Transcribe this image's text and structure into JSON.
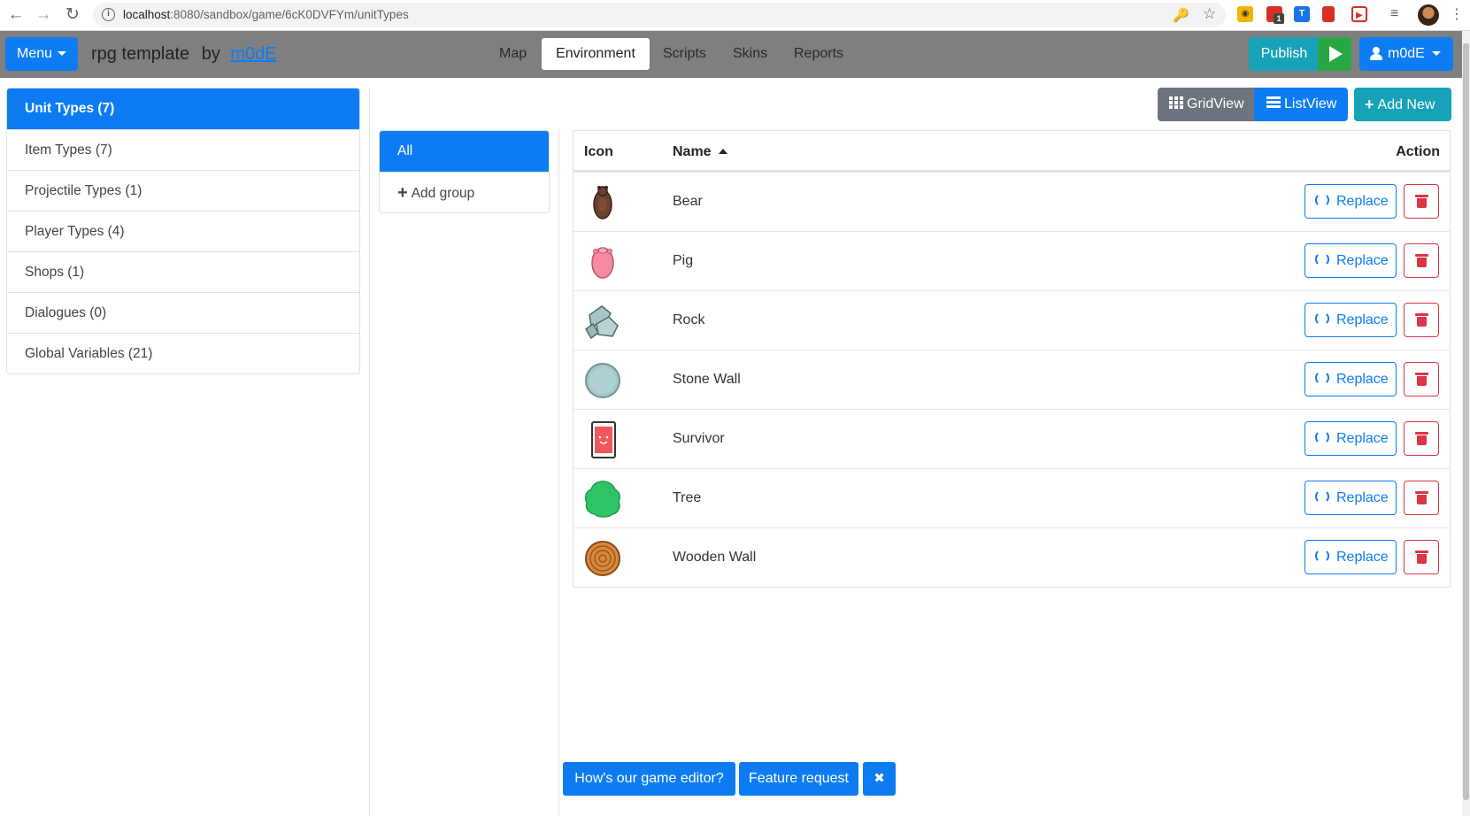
{
  "browser": {
    "url_host": "localhost",
    "url_rest": ":8080/sandbox/game/6cK0DVFYm/unitTypes",
    "extension_badge": "1"
  },
  "header": {
    "menu_label": "Menu",
    "game_title": "rpg template",
    "by_label": "by",
    "author": "m0dE",
    "tabs": [
      {
        "label": "Map"
      },
      {
        "label": "Environment"
      },
      {
        "label": "Scripts"
      },
      {
        "label": "Skins"
      },
      {
        "label": "Reports"
      }
    ],
    "publish_label": "Publish",
    "user_label": "m0dE"
  },
  "sidebar": {
    "items": [
      {
        "label": "Unit Types (7)"
      },
      {
        "label": "Item Types (7)"
      },
      {
        "label": "Projectile Types (1)"
      },
      {
        "label": "Player Types (4)"
      },
      {
        "label": "Shops (1)"
      },
      {
        "label": "Dialogues (0)"
      },
      {
        "label": "Global Variables (21)"
      }
    ]
  },
  "groups": {
    "all_label": "All",
    "add_label": "Add group"
  },
  "toolbar": {
    "grid_label": "GridView",
    "list_label": "ListView",
    "add_new_label": "Add New"
  },
  "table": {
    "headers": {
      "icon": "Icon",
      "name": "Name",
      "action": "Action"
    },
    "replace_label": "Replace",
    "rows": [
      {
        "name": "Bear",
        "icon": "bear-icon"
      },
      {
        "name": "Pig",
        "icon": "pig-icon"
      },
      {
        "name": "Rock",
        "icon": "rock-icon"
      },
      {
        "name": "Stone Wall",
        "icon": "stone-wall-icon"
      },
      {
        "name": "Survivor",
        "icon": "survivor-icon"
      },
      {
        "name": "Tree",
        "icon": "tree-icon"
      },
      {
        "name": "Wooden Wall",
        "icon": "wooden-wall-icon"
      }
    ]
  },
  "feedback": {
    "survey_label": "How's our game editor?",
    "feature_label": "Feature request",
    "close_label": "✖"
  },
  "colors": {
    "primary": "#0d7cf2",
    "info": "#17a2b8",
    "success": "#28a745",
    "danger": "#dc3545",
    "secondary": "#6c757d",
    "navbar": "#7f7f7f"
  }
}
